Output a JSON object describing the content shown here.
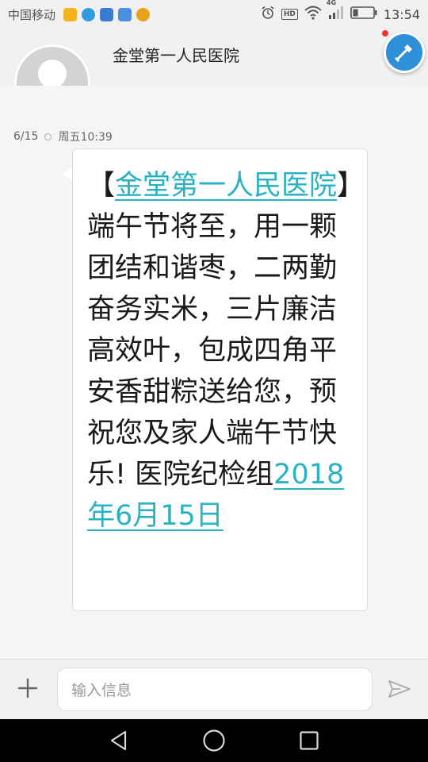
{
  "status_bar": {
    "carrier": "中国移动",
    "network": "4G",
    "time": "13:54",
    "app_icons": [
      "app-icon-1",
      "app-icon-2",
      "shield-icon",
      "app-icon-4",
      "weibo-icon"
    ]
  },
  "header": {
    "contact_name": "金堂第一人民医院",
    "avatar": "default-avatar"
  },
  "timestamp": {
    "date": "6/15",
    "time": "周五10:39"
  },
  "message": {
    "open_bracket": "【",
    "sender_link": "金堂第一人民医院",
    "body": "】端午节将至，用一颗团结和谐枣，二两勤奋务实米，三片廉洁高效叶，包成四角平安香甜粽送给您，预祝您及家人端午节快乐! 医院纪检组",
    "date_link": "2018年6月15日"
  },
  "composer": {
    "placeholder": "输入信息"
  },
  "colors": {
    "link": "#2ab2c2",
    "fab": "#2f8fd8",
    "nav_bg": "#000000"
  }
}
